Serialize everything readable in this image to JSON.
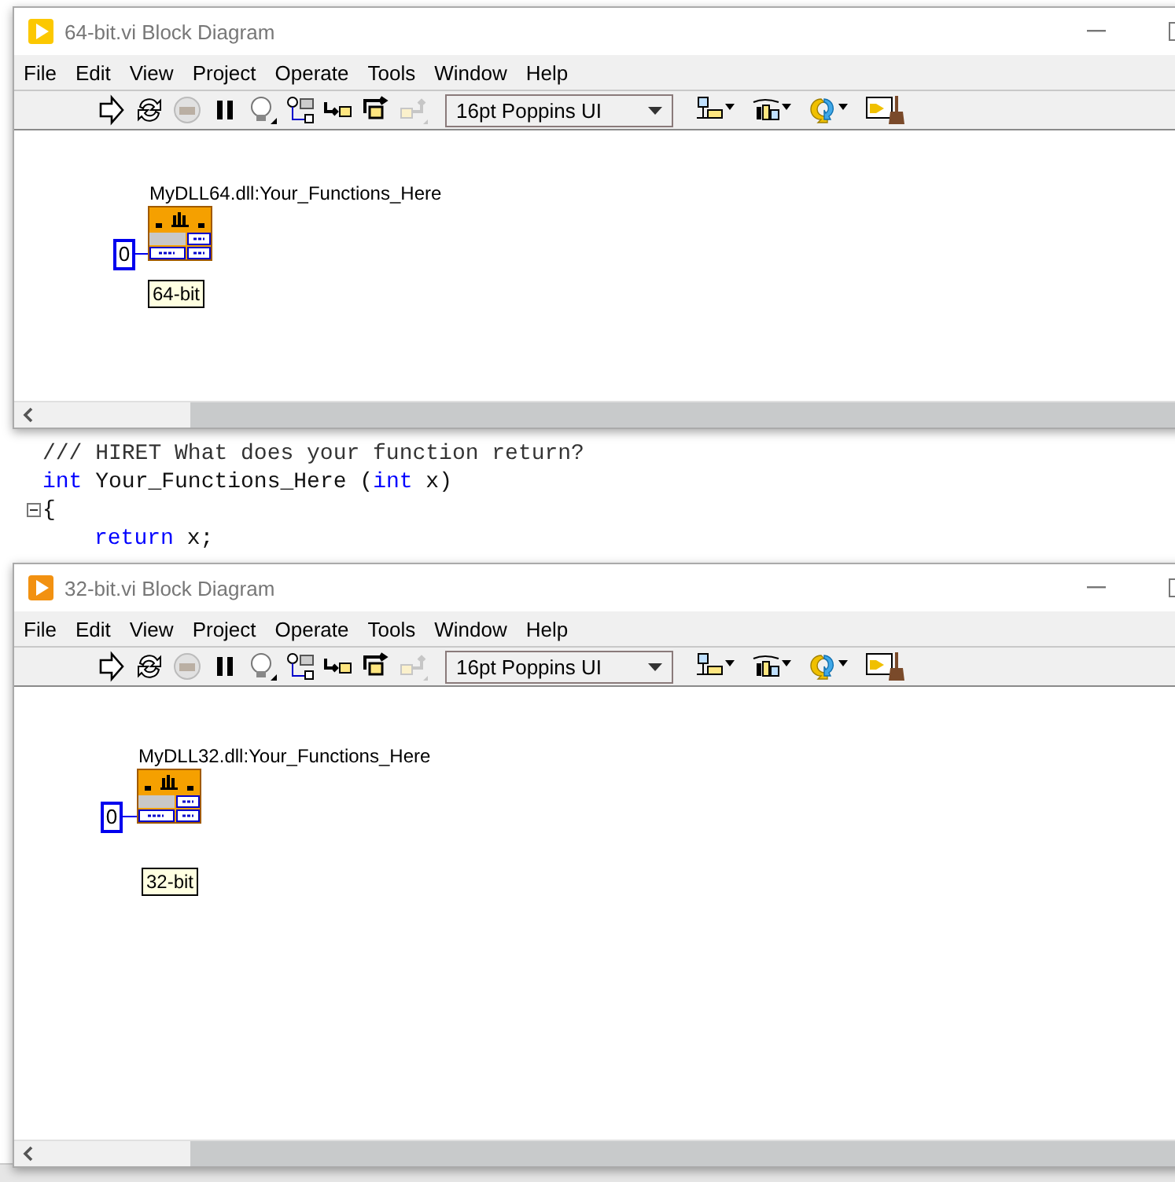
{
  "editor": {
    "lines": [
      {
        "parts": [
          {
            "kind": "comment",
            "text": "/// HIRET What does your function return?"
          }
        ]
      },
      {
        "parts": [
          {
            "kind": "keyword",
            "text": "int"
          },
          {
            "kind": "plain",
            "text": " Your_Functions_Here ("
          },
          {
            "kind": "keyword",
            "text": "int"
          },
          {
            "kind": "plain",
            "text": " x)"
          }
        ]
      },
      {
        "expanded": true,
        "parts": [
          {
            "kind": "plain",
            "text": "{"
          }
        ],
        "children": [
          {
            "parts": [
              {
                "kind": "keyword",
                "text": "return"
              },
              {
                "kind": "plain",
                "text": " x;"
              }
            ]
          }
        ]
      }
    ]
  },
  "windows": [
    {
      "title": "64-bit.vi Block Diagram",
      "color": "#fcc800",
      "menu": [
        "File",
        "Edit",
        "View",
        "Project",
        "Operate",
        "Tools",
        "Window",
        "Help"
      ],
      "tools": [
        {
          "kind": "run",
          "disabled": false
        },
        {
          "kind": "run-continuous",
          "disabled": false
        },
        {
          "kind": "abort",
          "disabled": true
        },
        {
          "kind": "pause",
          "disabled": false
        },
        {
          "kind": "highlight",
          "disabled": false
        },
        {
          "kind": "retain",
          "disabled": false
        },
        {
          "kind": "step-into",
          "disabled": false
        },
        {
          "kind": "step-over",
          "disabled": false
        },
        {
          "kind": "step-out",
          "disabled": true
        }
      ],
      "font": "16pt Poppins UI",
      "node": {
        "name": "MyDLL64.dll:Your_Functions_Here",
        "constant": "0",
        "label": "64-bit"
      }
    },
    {
      "title": "32-bit.vi Block Diagram",
      "color": "#f29111",
      "menu": [
        "File",
        "Edit",
        "View",
        "Project",
        "Operate",
        "Tools",
        "Window",
        "Help"
      ],
      "tools": [
        {
          "kind": "run",
          "disabled": false
        },
        {
          "kind": "run-continuous",
          "disabled": false
        },
        {
          "kind": "abort",
          "disabled": true
        },
        {
          "kind": "pause",
          "disabled": false
        },
        {
          "kind": "highlight",
          "disabled": false
        },
        {
          "kind": "retain",
          "disabled": false
        },
        {
          "kind": "step-into",
          "disabled": false
        },
        {
          "kind": "step-over",
          "disabled": false
        },
        {
          "kind": "step-out",
          "disabled": true
        }
      ],
      "font": "16pt Poppins UI",
      "node": {
        "name": "MyDLL32.dll:Your_Functions_Here",
        "constant": "0",
        "label": "32-bit"
      }
    }
  ]
}
